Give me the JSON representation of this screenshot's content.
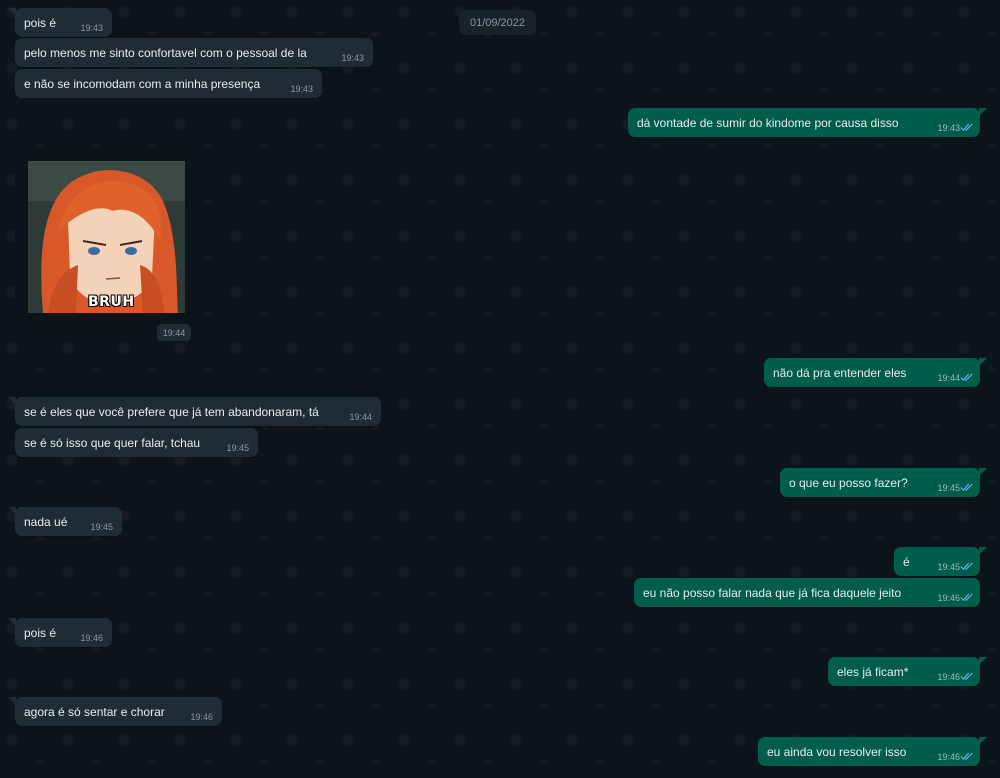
{
  "chat": {
    "date": "01/09/2022",
    "image_caption": "BRUH",
    "image_time": "19:44",
    "messages": [
      {
        "text": "pois é",
        "time": "19:43"
      },
      {
        "text": "pelo menos me sinto confortavel com o pessoal de la",
        "time": "19:43"
      },
      {
        "text": "e não se incomodam com a minha presença",
        "time": "19:43"
      },
      {
        "text": "dá vontade de sumir do kindome por causa disso",
        "time": "19:43"
      },
      {
        "text": "não dá pra entender eles",
        "time": "19:44"
      },
      {
        "text": "se é eles que você prefere que já tem abandonaram, tá",
        "time": "19:44"
      },
      {
        "text": "se é só isso que quer falar, tchau",
        "time": "19:45"
      },
      {
        "text": "o que eu posso fazer?",
        "time": "19:45"
      },
      {
        "text": "nada ué",
        "time": "19:45"
      },
      {
        "text": "é",
        "time": "19:45"
      },
      {
        "text": "eu não posso falar nada que já fica daquele jeito",
        "time": "19:46"
      },
      {
        "text": "pois é",
        "time": "19:46"
      },
      {
        "text": "eles já ficam*",
        "time": "19:46"
      },
      {
        "text": "agora é só sentar e chorar",
        "time": "19:46"
      },
      {
        "text": "eu ainda vou resolver isso",
        "time": "19:46"
      }
    ]
  },
  "colors": {
    "background": "#0b141a",
    "incoming_bubble": "#202c33",
    "outgoing_bubble": "#005c4b",
    "read_ticks": "#53bdeb"
  }
}
